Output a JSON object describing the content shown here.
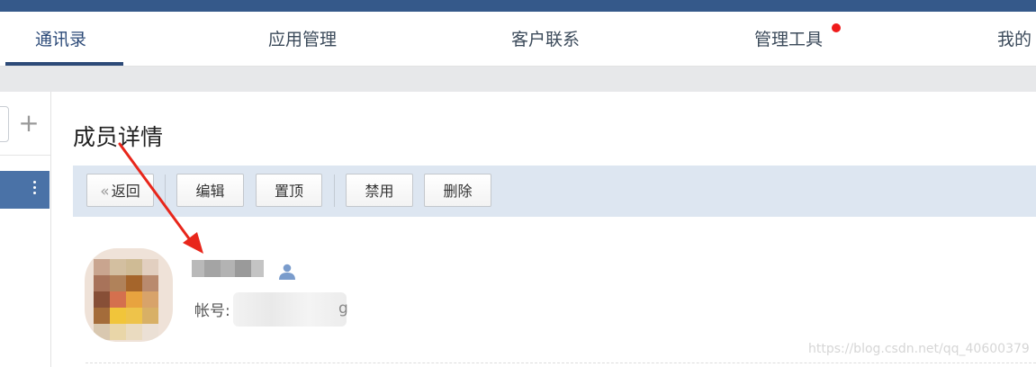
{
  "nav": {
    "tabs": [
      {
        "label": "通讯录",
        "active": true
      },
      {
        "label": "应用管理",
        "active": false
      },
      {
        "label": "客户联系",
        "active": false
      },
      {
        "label": "管理工具",
        "active": false,
        "has_notification": true
      },
      {
        "label": "我的",
        "active": false
      }
    ]
  },
  "sidebar": {
    "add_icon": "plus-icon",
    "more_icon": "vertical-dots-icon"
  },
  "main": {
    "title": "成员详情",
    "toolbar": {
      "back_label": "返回",
      "edit_label": "编辑",
      "pin_label": "置顶",
      "disable_label": "禁用",
      "delete_label": "删除"
    },
    "member": {
      "account_label": "帐号:",
      "account_visible_tail": "g",
      "user_icon": "user-icon"
    }
  },
  "watermark": "https://blog.csdn.net/qq_40600379",
  "colors": {
    "header_bar": "#35598a",
    "accent": "#2c4a78",
    "toolbar_bg": "#dde6f1",
    "sidebar_selected": "#4a72a7",
    "notification_dot": "#ef1b1b",
    "annotation_arrow": "#e8261b"
  }
}
